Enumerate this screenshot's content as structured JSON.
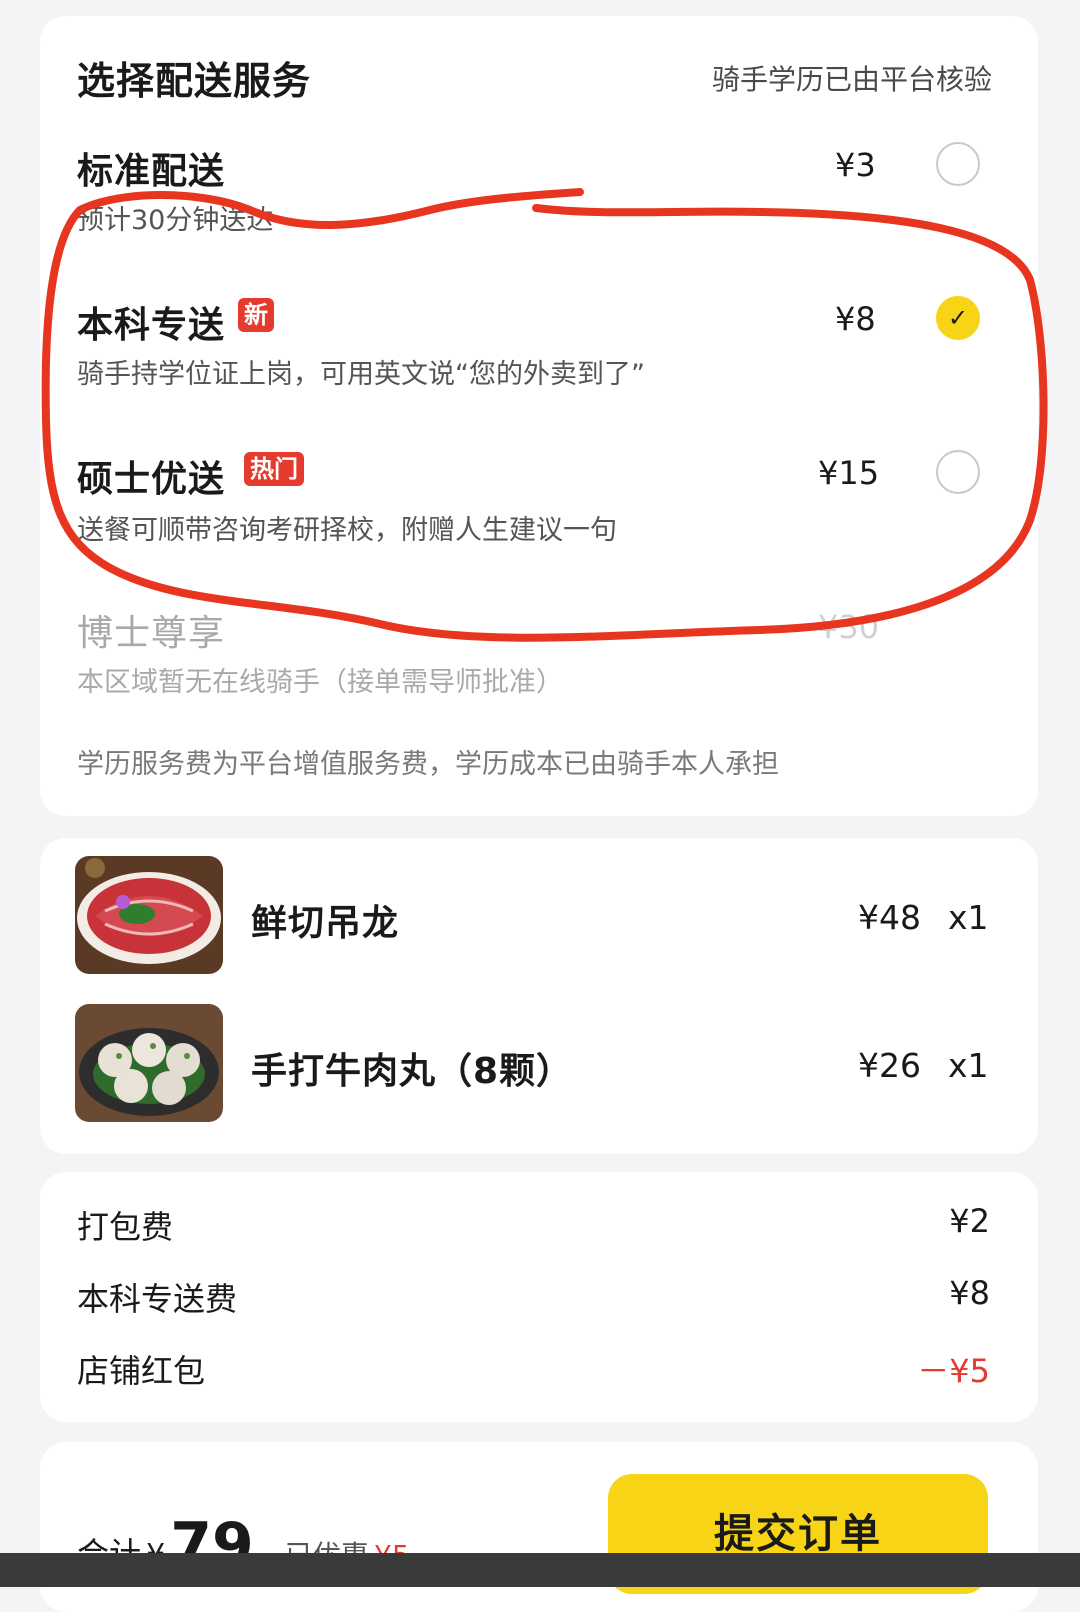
{
  "delivery": {
    "title": "选择配送服务",
    "verify_note": "骑手学历已由平台核验",
    "options": [
      {
        "name": "标准配送",
        "desc": "预计30分钟送达",
        "price": "¥3",
        "tag": "",
        "selected": false,
        "disabled": false
      },
      {
        "name": "本科专送",
        "desc": "骑手持学位证上岗，可用英文说“您的外卖到了”",
        "price": "¥8",
        "tag": "新",
        "selected": true,
        "disabled": false
      },
      {
        "name": "硕士优送",
        "desc": "送餐可顺带咨询考研择校，附赠人生建议一句",
        "price": "¥15",
        "tag": "热门",
        "selected": false,
        "disabled": false
      },
      {
        "name": "博士尊享",
        "desc": "本区域暂无在线骑手（接单需导师批准）",
        "price": "¥30",
        "tag": "",
        "selected": false,
        "disabled": true
      }
    ],
    "footnote": "学历服务费为平台增值服务费，学历成本已由骑手本人承担"
  },
  "items": [
    {
      "name": "鲜切吊龙",
      "price": "¥48",
      "qty": "x1",
      "image_icon": "sliced-beef-plate-icon"
    },
    {
      "name": "手打牛肉丸（8颗）",
      "price": "¥26",
      "qty": "x1",
      "image_icon": "beef-balls-plate-icon"
    }
  ],
  "fees": [
    {
      "label": "打包费",
      "value": "¥2",
      "negative": false
    },
    {
      "label": "本科专送费",
      "value": "¥8",
      "negative": false
    },
    {
      "label": "店铺红包",
      "value": "－¥5",
      "negative": true
    }
  ],
  "footer": {
    "total_label": "合计",
    "currency": "¥",
    "total": "79",
    "discount_label": "已优惠",
    "discount": "¥5",
    "submit_label": "提交订单"
  },
  "colors": {
    "accent_yellow": "#f7d416",
    "tag_red": "#e43b2e",
    "annotation_red": "#e8351f"
  }
}
